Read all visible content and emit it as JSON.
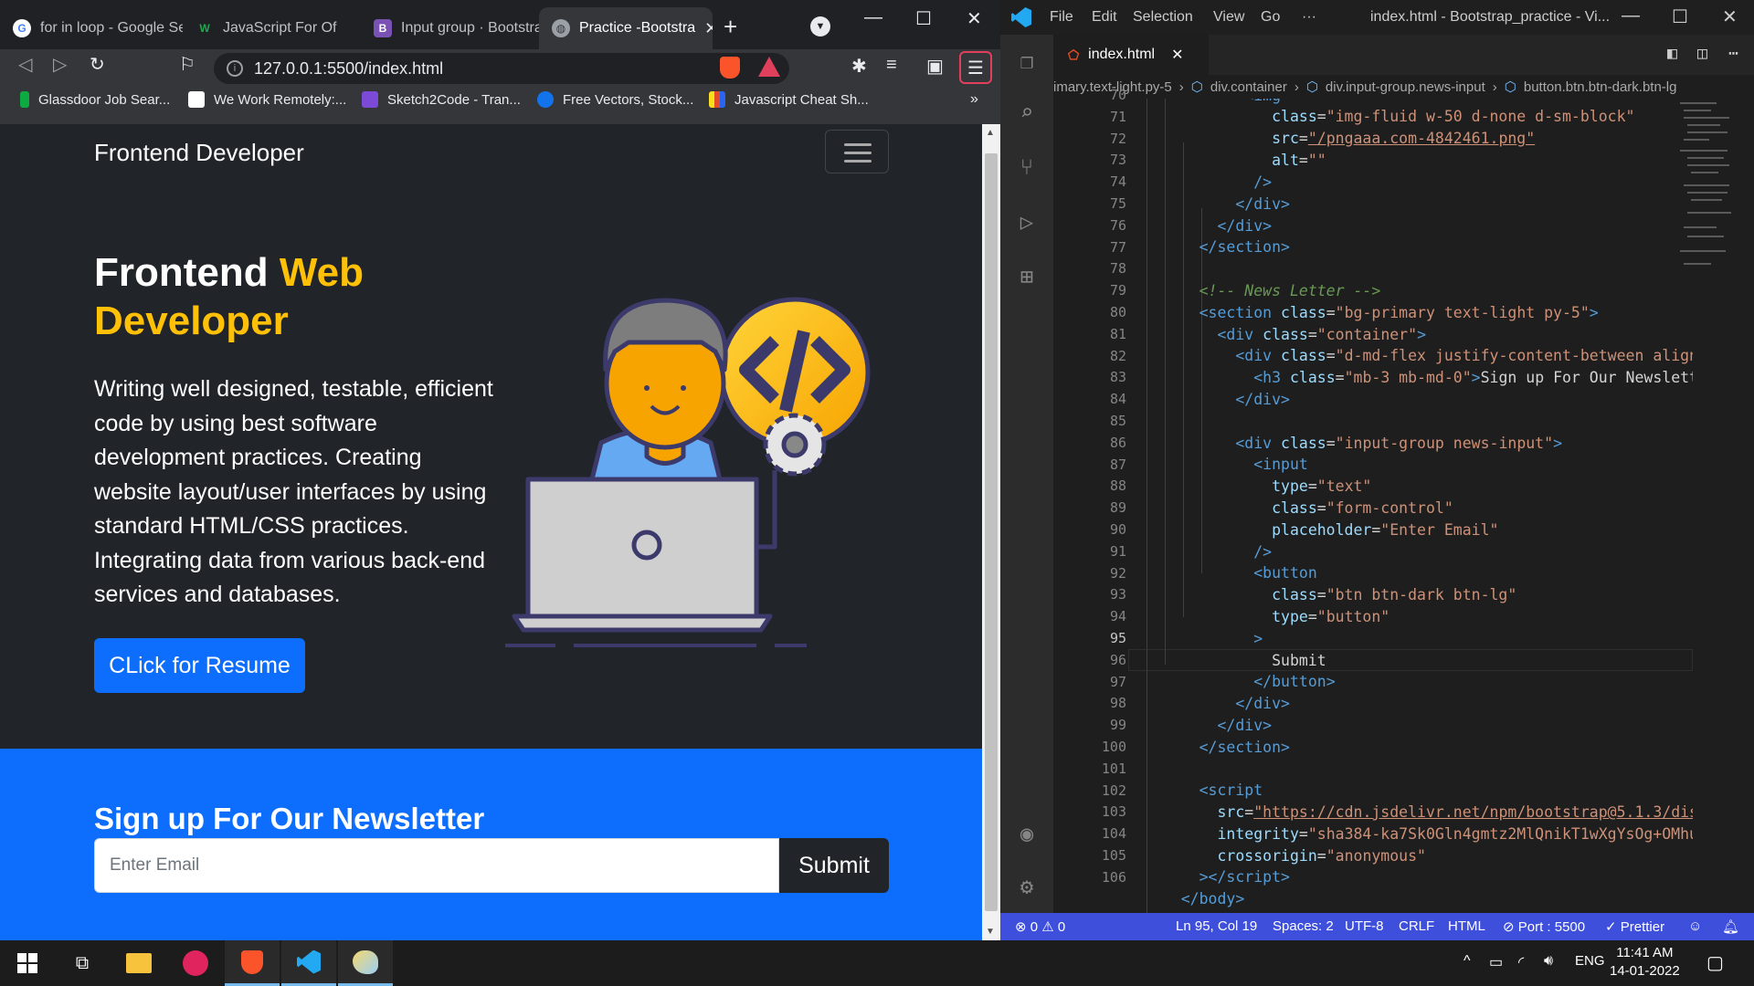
{
  "browser": {
    "tabs": [
      {
        "label": "for in loop - Google Se"
      },
      {
        "label": "JavaScript For Of"
      },
      {
        "label": "Input group · Bootstra"
      },
      {
        "label": "Practice -Bootstra"
      }
    ],
    "url": "127.0.0.1:5500/index.html",
    "bookmarks": [
      {
        "label": "Glassdoor Job Sear..."
      },
      {
        "label": "We Work Remotely:..."
      },
      {
        "label": "Sketch2Code - Tran..."
      },
      {
        "label": "Free Vectors, Stock..."
      },
      {
        "label": "Javascript Cheat Sh..."
      }
    ]
  },
  "page": {
    "brand": "Frontend Developer",
    "hero_title_1": "Frontend ",
    "hero_title_hl": "Web Developer",
    "hero_text": "Writing well designed, testable, efficient code by using best software development practices. Creating website layout/user interfaces by using standard HTML/CSS practices. Integrating data from various back-end services and databases.",
    "resume_button": "CLick for Resume",
    "newsletter_title": "Sign up For Our Newsletter",
    "email_placeholder": "Enter Email",
    "submit_button": "Submit"
  },
  "vscode": {
    "menu": [
      "File",
      "Edit",
      "Selection",
      "View",
      "Go",
      "···"
    ],
    "window_title": "index.html - Bootstrap_practice - Vi...",
    "tab": "index.html",
    "breadcrumb": [
      "imary.text-light.py-5",
      "div.container",
      "div.input-group.news-input",
      "button.btn.btn-dark.btn-lg"
    ],
    "line_numbers": [
      "70",
      "71",
      "72",
      "73",
      "74",
      "75",
      "76",
      "77",
      "78",
      "79",
      "80",
      "81",
      "82",
      "83",
      "84",
      "85",
      "86",
      "87",
      "88",
      "89",
      "90",
      "91",
      "92",
      "93",
      "94",
      "95",
      "96",
      "97",
      "98",
      "99",
      "100",
      "101",
      "102",
      "103",
      "104",
      "105",
      "106"
    ],
    "status": {
      "problems": "⊗ 0 ⚠ 0",
      "position": "Ln 95, Col 19",
      "spaces": "Spaces: 2",
      "encoding": "UTF-8",
      "eol": "CRLF",
      "language": "HTML",
      "port": "⊘ Port : 5500",
      "prettier": "✓ Prettier"
    }
  },
  "taskbar": {
    "lang": "ENG",
    "time": "11:41 AM",
    "date": "14-01-2022"
  },
  "colors": {
    "primary": "#0d6efd",
    "warning": "#ffc107",
    "dark": "#212529",
    "vscode_status": "#3e4fdc"
  }
}
